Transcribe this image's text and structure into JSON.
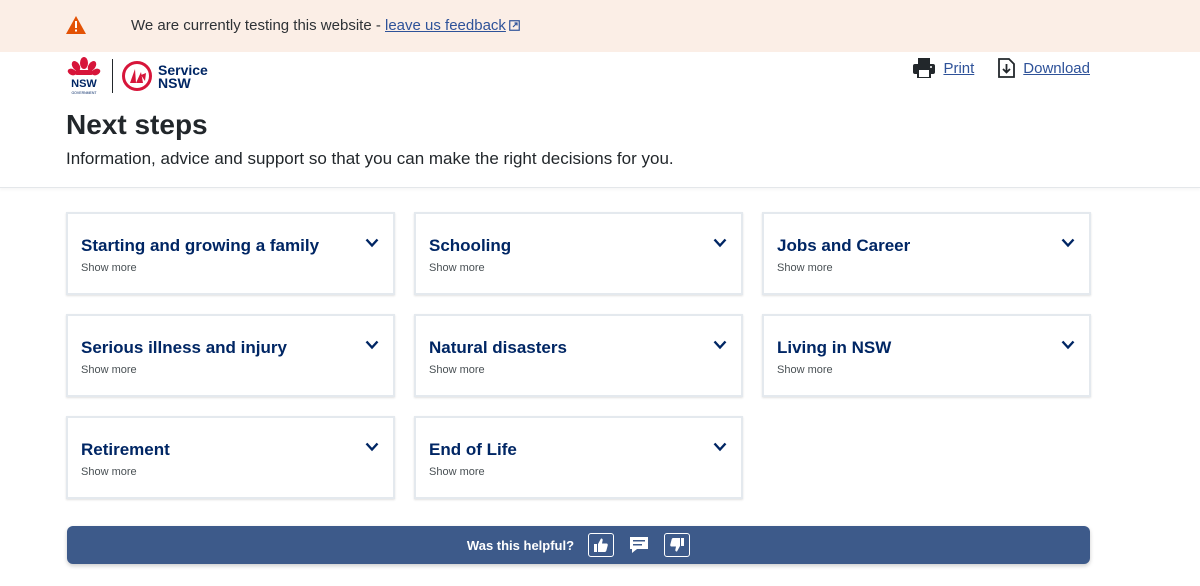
{
  "banner": {
    "message": "We are currently testing this website - ",
    "link": "leave us feedback",
    "icon": "warning-icon"
  },
  "brand": {
    "service_line1": "Service",
    "service_line2": "NSW"
  },
  "actions": {
    "print": "Print",
    "download": "Download"
  },
  "page": {
    "title": "Next steps",
    "subtitle": "Information, advice and support so that you can make the right decisions for you."
  },
  "cards": [
    {
      "title": "Starting and growing a family",
      "more": "Show more"
    },
    {
      "title": "Schooling",
      "more": "Show more"
    },
    {
      "title": "Jobs and Career",
      "more": "Show more"
    },
    {
      "title": "Serious illness and injury",
      "more": "Show more"
    },
    {
      "title": "Natural disasters",
      "more": "Show more"
    },
    {
      "title": "Living in NSW",
      "more": "Show more"
    },
    {
      "title": "Retirement",
      "more": "Show more"
    },
    {
      "title": "End of Life",
      "more": "Show more"
    }
  ],
  "feedback": {
    "label": "Was this helpful?"
  },
  "colors": {
    "banner_bg": "#fbeee6",
    "warning": "#e35205",
    "link": "#2e5299",
    "navy": "#002664",
    "nsw_red": "#d7153a",
    "feedback_bar": "#3d5a8a"
  }
}
